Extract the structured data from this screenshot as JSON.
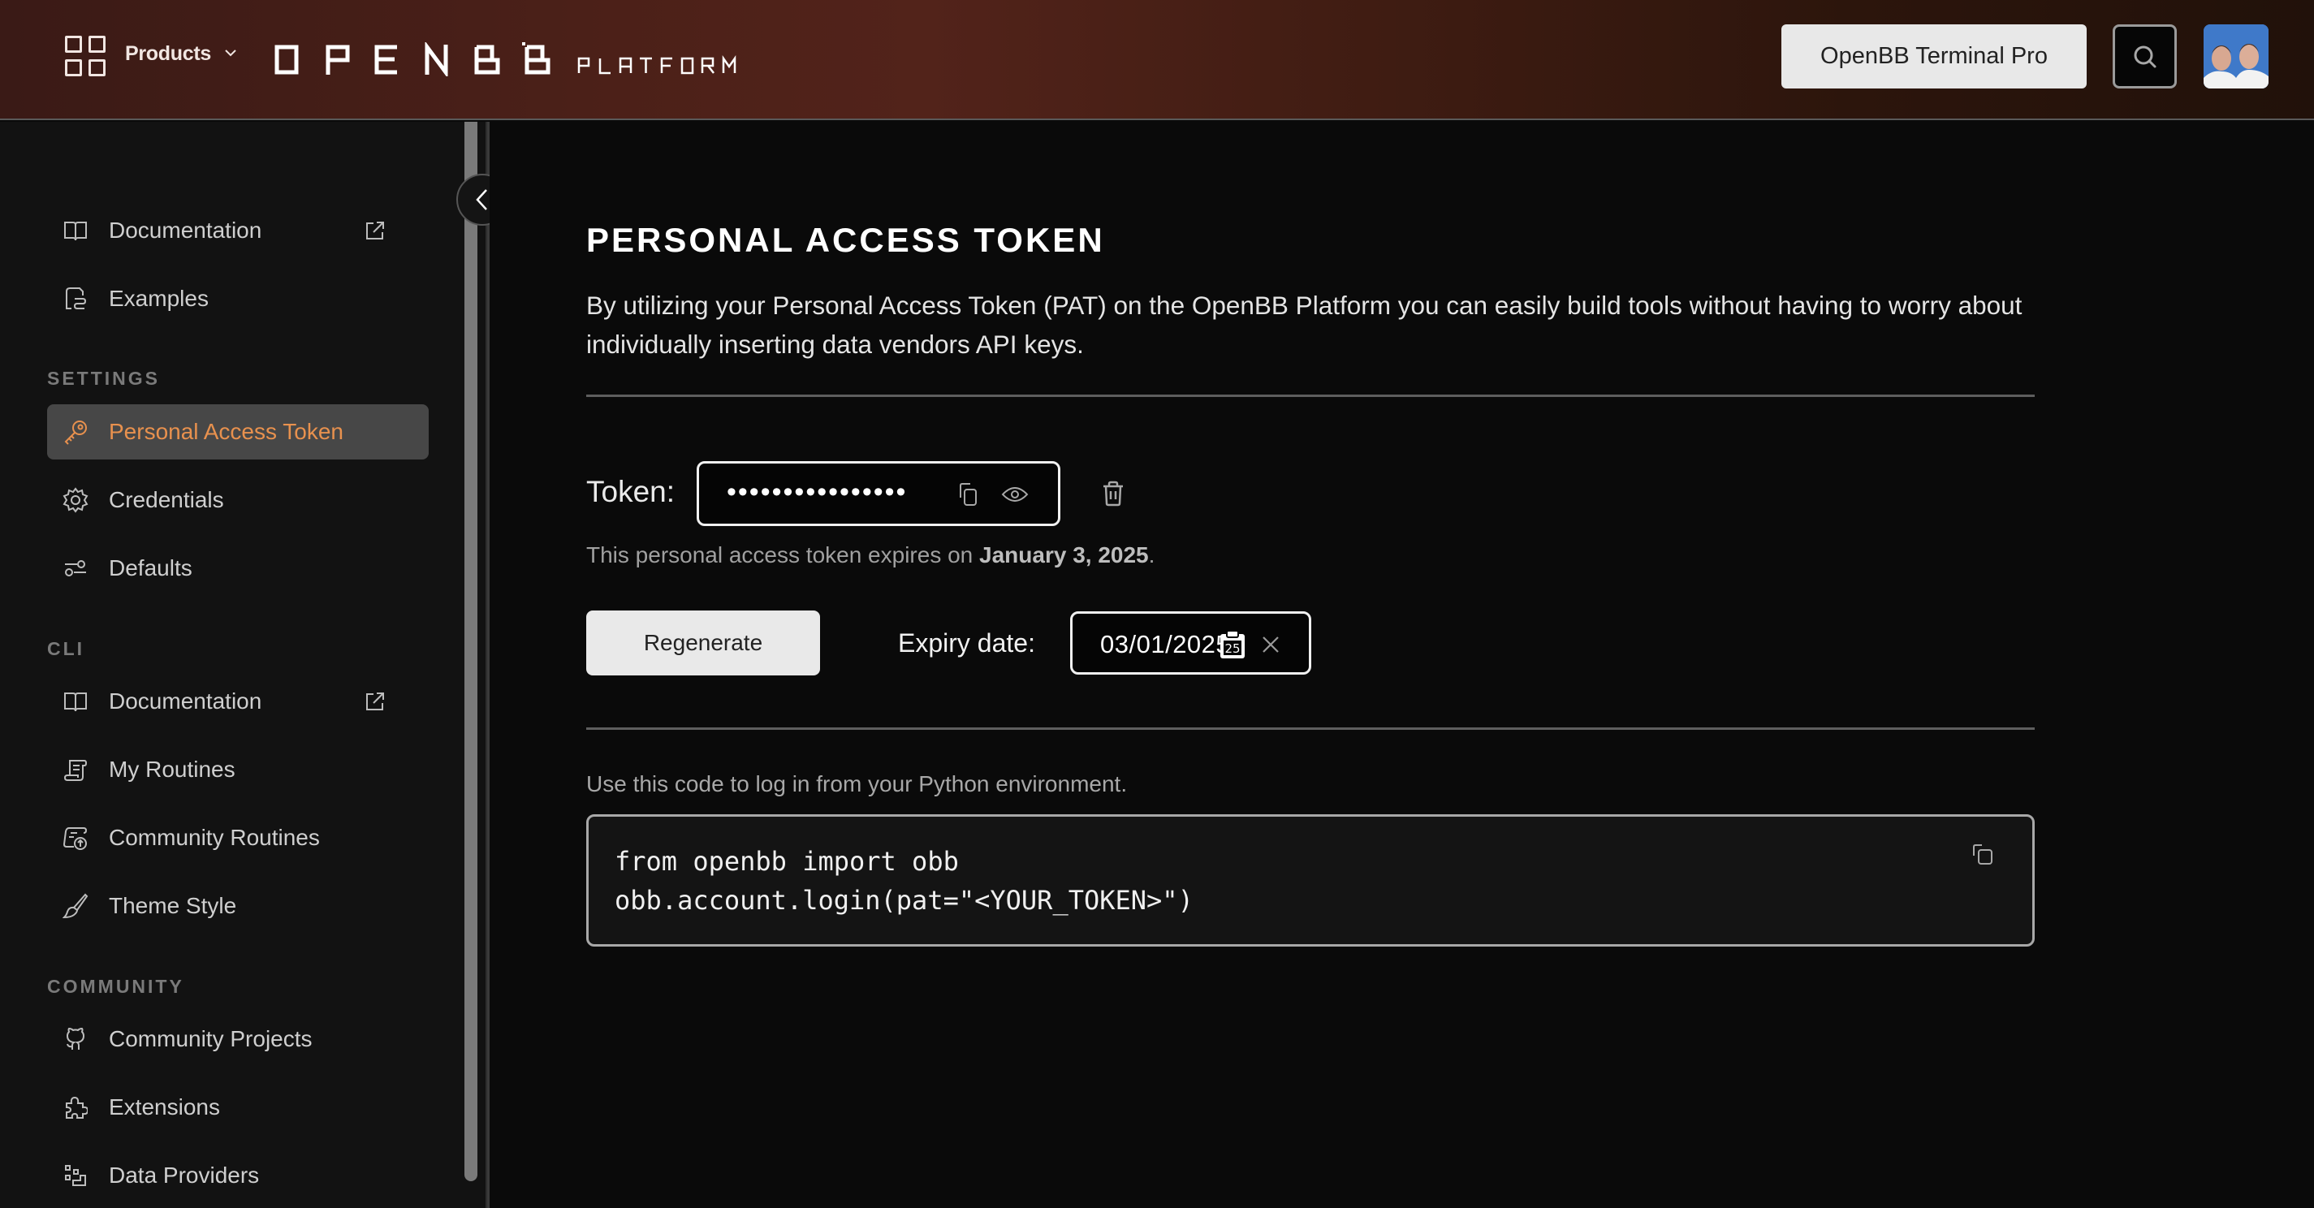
{
  "header": {
    "products_label": "Products",
    "logo_text": "OPENBB",
    "logo_subtext": "PLATFORM",
    "pro_button_label": "OpenBB Terminal Pro",
    "search_icon": "search-icon",
    "avatar_alt": "User avatar"
  },
  "sidebar": {
    "collapse_icon": "chevron-left-icon",
    "top_items": [
      {
        "label": "Documentation",
        "icon": "book-icon",
        "external": true
      },
      {
        "label": "Examples",
        "icon": "file-code-icon",
        "external": false
      }
    ],
    "sections": [
      {
        "title": "SETTINGS",
        "items": [
          {
            "label": "Personal Access Token",
            "icon": "key-icon",
            "active": true
          },
          {
            "label": "Credentials",
            "icon": "gear-icon",
            "active": false
          },
          {
            "label": "Defaults",
            "icon": "sliders-icon",
            "active": false
          }
        ]
      },
      {
        "title": "CLI",
        "items": [
          {
            "label": "Documentation",
            "icon": "book-icon",
            "external": true
          },
          {
            "label": "My Routines",
            "icon": "scroll-icon"
          },
          {
            "label": "Community Routines",
            "icon": "scroll-upload-icon"
          },
          {
            "label": "Theme Style",
            "icon": "brush-icon"
          }
        ]
      },
      {
        "title": "COMMUNITY",
        "items": [
          {
            "label": "Community Projects",
            "icon": "github-icon"
          },
          {
            "label": "Extensions",
            "icon": "puzzle-icon"
          },
          {
            "label": "Data Providers",
            "icon": "data-providers-icon"
          }
        ]
      }
    ]
  },
  "main": {
    "title": "PERSONAL ACCESS TOKEN",
    "description": "By utilizing your Personal Access Token (PAT) on the OpenBB Platform you can easily build tools without having to worry about individually inserting data vendors API keys.",
    "token_label": "Token:",
    "token_value_masked": "••••••••••••••••",
    "expiry_note_prefix": "This personal access token expires on ",
    "expiry_note_date": "January 3, 2025",
    "expiry_note_suffix": ".",
    "regenerate_label": "Regenerate",
    "expiry_date_label": "Expiry date:",
    "expiry_date_value": "03/01/2025",
    "code_hint": "Use this code to log in from your Python environment.",
    "code_lines": [
      "from openbb import obb",
      "obb.account.login(pat=\"<YOUR_TOKEN>\")"
    ]
  },
  "colors": {
    "accent_active": "#e8914e",
    "active_bg": "#474747",
    "background": "#0a0a0a",
    "sidebar_bg": "#121212"
  }
}
